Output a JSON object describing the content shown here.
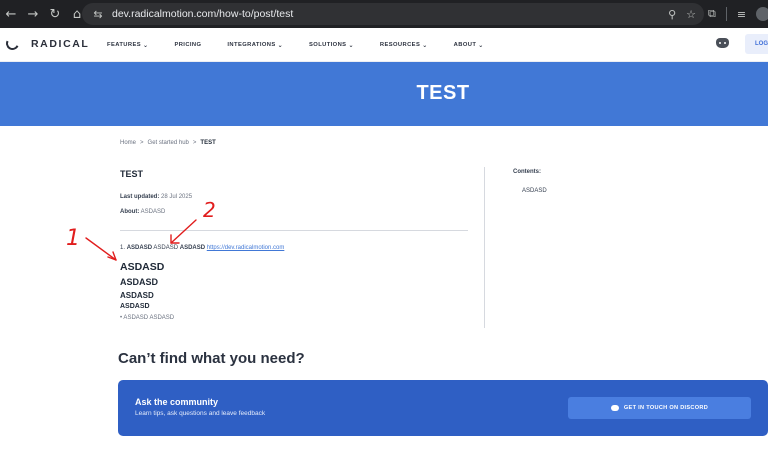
{
  "browser": {
    "url": "dev.radicalmotion.com/how-to/post/test",
    "nav_icons": [
      "back-icon",
      "forward-icon",
      "reload-icon",
      "home-icon"
    ],
    "back_glyph": "←",
    "forward_glyph": "→",
    "reload_glyph": "↻",
    "home_glyph": "⌂",
    "site_glyph": "⇆",
    "zoom_glyph": "⚲",
    "star_glyph": "☆",
    "extensions_glyph": "⧉",
    "menu_glyph": "≡"
  },
  "header": {
    "logo_text": "RADICAL",
    "menu": [
      {
        "label": "FEATURES",
        "has_dropdown": true
      },
      {
        "label": "PRICING",
        "has_dropdown": false
      },
      {
        "label": "INTEGRATIONS",
        "has_dropdown": true
      },
      {
        "label": "SOLUTIONS",
        "has_dropdown": true
      },
      {
        "label": "RESOURCES",
        "has_dropdown": true
      },
      {
        "label": "ABOUT",
        "has_dropdown": true
      }
    ],
    "chevron": "⌄",
    "login_label": "LOG"
  },
  "hero": {
    "title": "TEST"
  },
  "breadcrumb": {
    "items": [
      "Home",
      "Get started hub"
    ],
    "separator": ">",
    "current": "TEST"
  },
  "article": {
    "title": "TEST",
    "updated_label": "Last updated:",
    "updated_value": "28 Jul 2025",
    "about_label": "About:",
    "about_value": "ASDASD",
    "list_number": "1.",
    "list_bold_1": "ASDASD",
    "list_plain": "ASDASD",
    "list_bold_2": "ASDASD",
    "list_link": "https://dev.radicalmotion.com",
    "heading_1": "ASDASD",
    "heading_2": "ASDASD",
    "heading_3": "ASDASD",
    "heading_4": "ASDASD",
    "bullet": "•  ASDASD ASDASD"
  },
  "contents": {
    "label": "Contents:",
    "items": [
      "ASDASD"
    ]
  },
  "annotations": {
    "label_1": "1",
    "label_2": "2",
    "color": "#e11d1d"
  },
  "footer_cta": {
    "heading": "Can’t find what you need?",
    "card_title": "Ask the community",
    "card_subtitle": "Learn tips, ask questions and leave feedback",
    "button_label": "GET IN TOUCH ON DISCORD"
  },
  "colors": {
    "brand_blue": "#4178d6",
    "card_blue": "#2f5fc4",
    "link": "#4178d6"
  }
}
